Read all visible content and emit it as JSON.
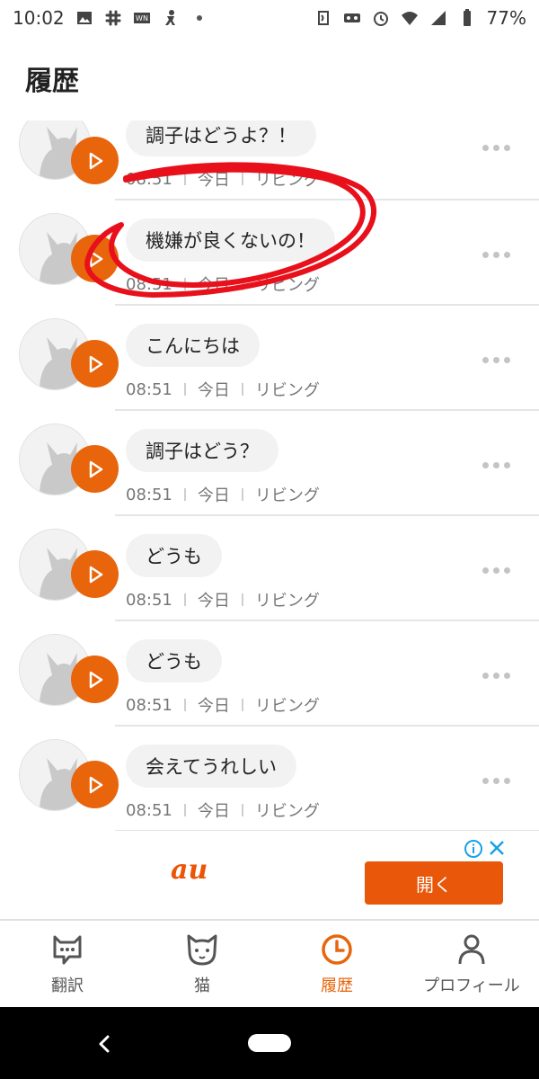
{
  "status_bar": {
    "time": "10:02",
    "battery": "77%"
  },
  "header": {
    "title": "履歴"
  },
  "history": {
    "items": [
      {
        "text": "調子はどうよ？！",
        "time": "08:51",
        "day": "今日",
        "room": "リビング"
      },
      {
        "text": "機嫌が良くないの！",
        "time": "08:51",
        "day": "今日",
        "room": "リビング"
      },
      {
        "text": "こんにちは",
        "time": "08:51",
        "day": "今日",
        "room": "リビング"
      },
      {
        "text": "調子はどう？",
        "time": "08:51",
        "day": "今日",
        "room": "リビング"
      },
      {
        "text": "どうも",
        "time": "08:51",
        "day": "今日",
        "room": "リビング"
      },
      {
        "text": "どうも",
        "time": "08:51",
        "day": "今日",
        "room": "リビング"
      },
      {
        "text": "会えてうれしい",
        "time": "08:51",
        "day": "今日",
        "room": "リビング"
      }
    ]
  },
  "ad": {
    "brand": "au",
    "open_label": "開く"
  },
  "bottom_nav": {
    "items": [
      {
        "label": "翻訳",
        "icon": "chat-cat-icon"
      },
      {
        "label": "猫",
        "icon": "cat-face-icon"
      },
      {
        "label": "履歴",
        "icon": "clock-icon"
      },
      {
        "label": "プロフィール",
        "icon": "person-icon"
      }
    ],
    "active_index": 2
  },
  "colors": {
    "accent": "#e8650c",
    "annotation": "#e8101b"
  }
}
